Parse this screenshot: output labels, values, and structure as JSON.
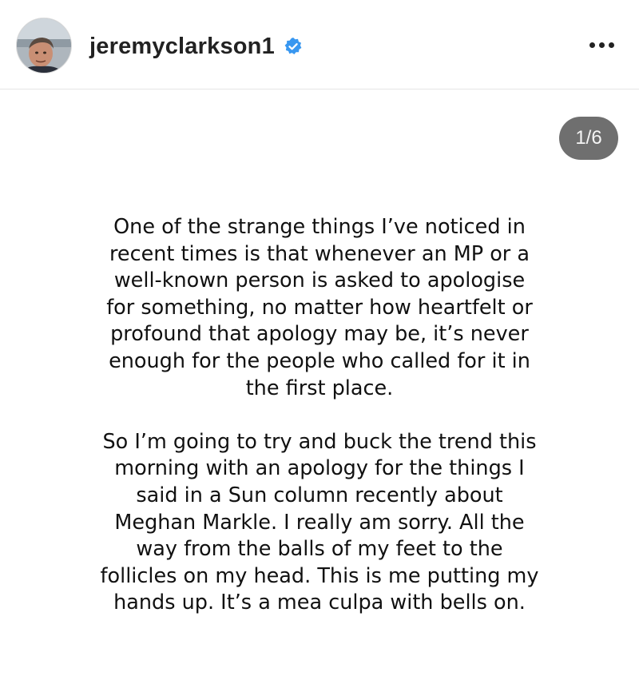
{
  "header": {
    "username": "jeremyclarkson1",
    "verified_icon": "verified-badge-icon",
    "avatar_icon": "profile-avatar",
    "more_icon": "more-options-icon"
  },
  "slide": {
    "counter": "1/6"
  },
  "post": {
    "paragraphs": [
      {
        "lines": [
          "One of the strange things I’ve noticed in",
          "recent times is that whenever an MP or a",
          "well-known person is asked to apologise",
          "for something, no matter how heartfelt or",
          "profound that apology may be, it’s never",
          "enough for the people who called for it in",
          "the first place."
        ]
      },
      {
        "lines": [
          "So I’m going to try and buck the trend this",
          "morning with an apology for the things I",
          "said in a Sun column recently about",
          "Meghan Markle. I really am sorry. All the",
          "way from the balls of my feet to the",
          "follicles on my head. This is me putting my",
          "hands up. It’s a mea culpa with bells on."
        ]
      }
    ]
  },
  "colors": {
    "verified": "#3897f0",
    "counter_bg": "#6f6f6f",
    "divider": "#e6e6e6"
  }
}
